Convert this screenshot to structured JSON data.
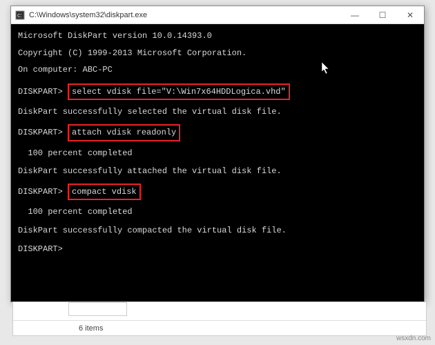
{
  "window": {
    "title": "C:\\Windows\\system32\\diskpart.exe",
    "minimize_label": "—",
    "maximize_label": "☐",
    "close_label": "✕"
  },
  "terminal": {
    "header1": "Microsoft DiskPart version 10.0.14393.0",
    "copyright": "Copyright (C) 1999-2013 Microsoft Corporation.",
    "on_computer": "On computer: ABC-PC",
    "prompt": "DISKPART>",
    "cmd1": "select vdisk file=\"V:\\Win7x64HDDLogica.vhd\"",
    "resp1": "DiskPart successfully selected the virtual disk file.",
    "cmd2": "attach vdisk readonly",
    "resp2": "  100 percent completed",
    "resp3": "DiskPart successfully attached the virtual disk file.",
    "cmd3": "compact vdisk",
    "resp4": "  100 percent completed",
    "resp5": "DiskPart successfully compacted the virtual disk file."
  },
  "explorer": {
    "status": "6 items"
  },
  "watermark": "wsxdn.com"
}
